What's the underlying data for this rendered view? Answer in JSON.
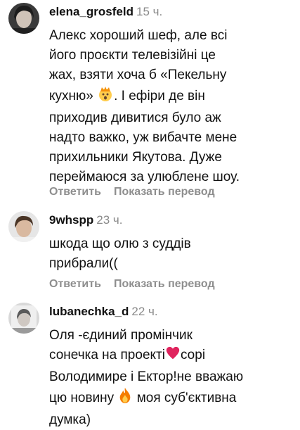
{
  "comments": [
    {
      "username": "elena_grosfeld",
      "time": "15 ч.",
      "lines": [
        "Алекс хороший шеф, але всі",
        "його проєкти телевізійні це",
        "жах, взяти хоча б «Пекельну",
        "кухню»",
        ". І ефіри де він",
        "приходив дивитися було аж",
        "надто важко, уж вибачте мене",
        "прихильники Якутова. Дуже",
        "переймаюся за улюблене шоу."
      ],
      "reply_label": "Ответить",
      "translate_label": "Показать перевод"
    },
    {
      "username": "9whspp",
      "time": "23 ч.",
      "lines": [
        "шкода що олю з суддів",
        "прибрали(("
      ],
      "reply_label": "Ответить",
      "translate_label": "Показать перевод"
    },
    {
      "username": "lubanechka_d",
      "time": "22 ч.",
      "lines": [
        "Оля -єдиний промінчик",
        "сонечка  на проекті",
        "сорі",
        "Володимире і Ектор!не вважаю",
        "цю новину",
        "моя суб'єктивна",
        "думка)"
      ]
    }
  ],
  "icons": {
    "emoji_1": "exploding-head-emoji",
    "emoji_2": "red-heart-emoji",
    "emoji_3": "fire-emoji"
  },
  "colors": {
    "secondary_text": "#8e8e8e",
    "heart": "#e0245e",
    "fire": "#f57c00"
  }
}
